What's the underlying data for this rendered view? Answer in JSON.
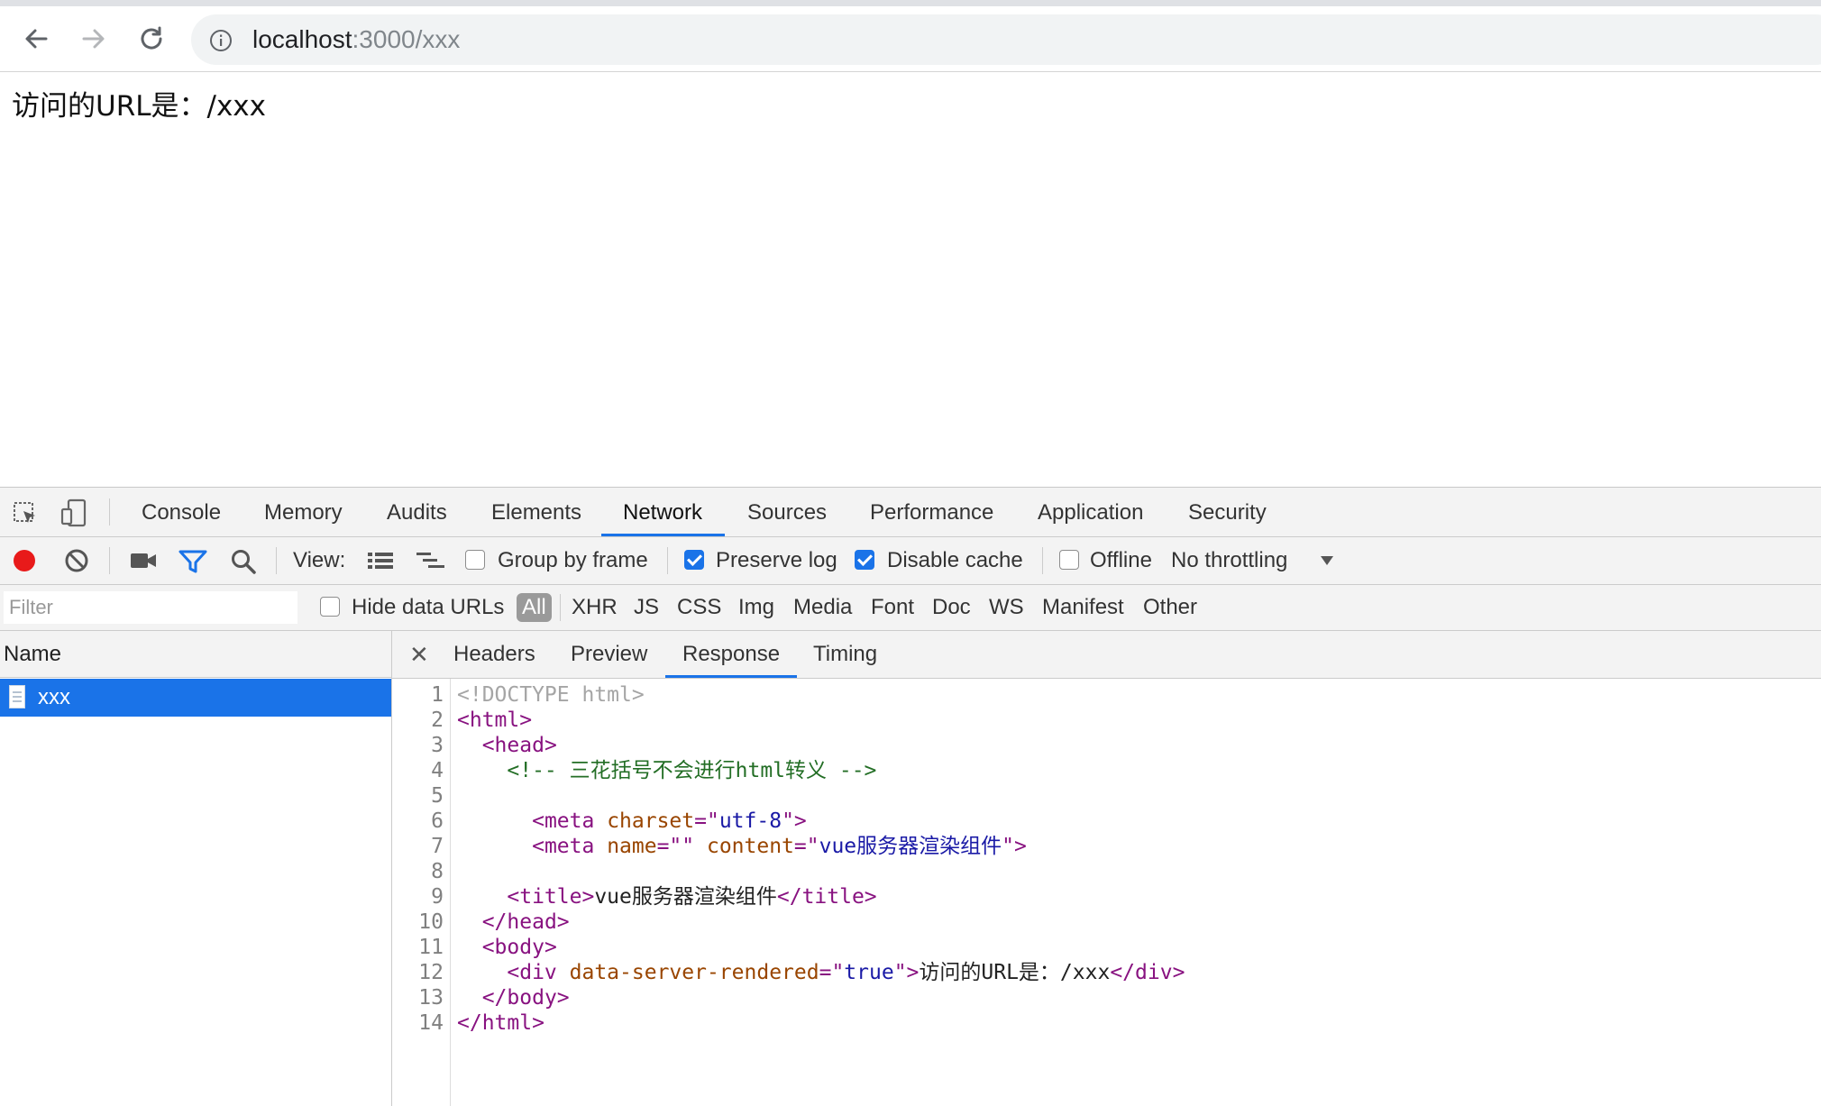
{
  "browser": {
    "url_host": "localhost",
    "url_rest": ":3000/xxx"
  },
  "page": {
    "content": "访问的URL是：/xxx"
  },
  "devtools": {
    "tabs": [
      "Console",
      "Memory",
      "Audits",
      "Elements",
      "Network",
      "Sources",
      "Performance",
      "Application",
      "Security"
    ],
    "active_tab": "Network",
    "toolbar": {
      "view_label": "View:",
      "group_by_frame": "Group by frame",
      "preserve_log": "Preserve log",
      "disable_cache": "Disable cache",
      "offline": "Offline",
      "throttling": "No throttling"
    },
    "filter": {
      "placeholder": "Filter",
      "hide_data_urls": "Hide data URLs",
      "types": [
        "All",
        "XHR",
        "JS",
        "CSS",
        "Img",
        "Media",
        "Font",
        "Doc",
        "WS",
        "Manifest",
        "Other"
      ]
    },
    "requests": {
      "header": "Name",
      "items": [
        "xxx"
      ]
    },
    "detail_tabs": [
      "Headers",
      "Preview",
      "Response",
      "Timing"
    ],
    "active_detail_tab": "Response",
    "response_lines": [
      {
        "n": "1",
        "indent": "",
        "parts": [
          {
            "t": "<!DOCTYPE html>",
            "c": "doctype"
          }
        ]
      },
      {
        "n": "2",
        "indent": "",
        "parts": [
          {
            "t": "<html>",
            "c": "tag"
          }
        ]
      },
      {
        "n": "3",
        "indent": "  ",
        "parts": [
          {
            "t": "<head>",
            "c": "tag"
          }
        ]
      },
      {
        "n": "4",
        "indent": "    ",
        "parts": [
          {
            "t": "<!-- 三花括号不会进行html转义 -->",
            "c": "comment"
          }
        ]
      },
      {
        "n": "5",
        "indent": "",
        "parts": []
      },
      {
        "n": "6",
        "indent": "      ",
        "parts": [
          {
            "t": "<meta ",
            "c": "tag"
          },
          {
            "t": "charset",
            "c": "attr"
          },
          {
            "t": "=\"",
            "c": "tag"
          },
          {
            "t": "utf-8",
            "c": "val"
          },
          {
            "t": "\">",
            "c": "tag"
          }
        ]
      },
      {
        "n": "7",
        "indent": "      ",
        "parts": [
          {
            "t": "<meta ",
            "c": "tag"
          },
          {
            "t": "name",
            "c": "attr"
          },
          {
            "t": "=\"\" ",
            "c": "tag"
          },
          {
            "t": "content",
            "c": "attr"
          },
          {
            "t": "=\"",
            "c": "tag"
          },
          {
            "t": "vue服务器渲染组件",
            "c": "val"
          },
          {
            "t": "\">",
            "c": "tag"
          }
        ]
      },
      {
        "n": "8",
        "indent": "",
        "parts": []
      },
      {
        "n": "9",
        "indent": "    ",
        "parts": [
          {
            "t": "<title>",
            "c": "tag"
          },
          {
            "t": "vue服务器渲染组件",
            "c": "text"
          },
          {
            "t": "</title>",
            "c": "tag"
          }
        ]
      },
      {
        "n": "10",
        "indent": "  ",
        "parts": [
          {
            "t": "</head>",
            "c": "tag"
          }
        ]
      },
      {
        "n": "11",
        "indent": "  ",
        "parts": [
          {
            "t": "<body>",
            "c": "tag"
          }
        ]
      },
      {
        "n": "12",
        "indent": "    ",
        "parts": [
          {
            "t": "<div ",
            "c": "tag"
          },
          {
            "t": "data-server-rendered",
            "c": "attr"
          },
          {
            "t": "=\"",
            "c": "tag"
          },
          {
            "t": "true",
            "c": "val"
          },
          {
            "t": "\">",
            "c": "tag"
          },
          {
            "t": "访问的URL是：/xxx",
            "c": "text"
          },
          {
            "t": "</div>",
            "c": "tag"
          }
        ]
      },
      {
        "n": "13",
        "indent": "  ",
        "parts": [
          {
            "t": "</body>",
            "c": "tag"
          }
        ]
      },
      {
        "n": "14",
        "indent": "",
        "parts": [
          {
            "t": "</html>",
            "c": "tag"
          }
        ]
      }
    ]
  }
}
